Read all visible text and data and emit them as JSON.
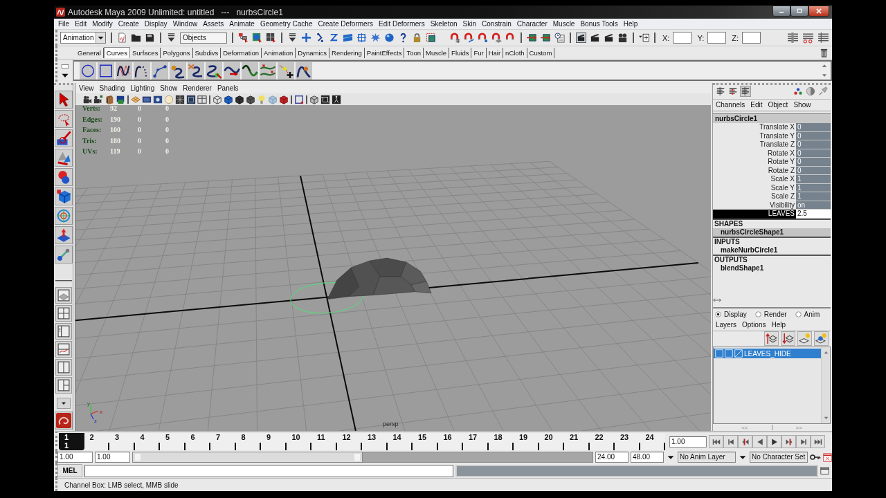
{
  "window": {
    "title": "Autodesk Maya 2009 Unlimited: untitled   ---   nurbsCircle1"
  },
  "menu_bar": [
    "File",
    "Edit",
    "Modify",
    "Create",
    "Display",
    "Window",
    "Assets",
    "Animate",
    "Geometry Cache",
    "Create Deformers",
    "Edit Deformers",
    "Skeleton",
    "Skin",
    "Constrain",
    "Character",
    "Muscle",
    "Bonus Tools",
    "Help"
  ],
  "status_line": {
    "menu_set": "Animation",
    "selection_mode": "Objects",
    "coordinates": [
      "X:",
      "Y:",
      "Z:"
    ]
  },
  "shelf": {
    "tabs": [
      {
        "label": "General",
        "selected": false
      },
      {
        "label": "Curves",
        "selected": true
      },
      {
        "label": "Surfaces",
        "selected": false
      },
      {
        "label": "Polygons",
        "selected": false
      },
      {
        "label": "Subdivs",
        "selected": false
      },
      {
        "label": "Deformation",
        "selected": false
      },
      {
        "label": "Animation",
        "selected": false
      },
      {
        "label": "Dynamics",
        "selected": false
      },
      {
        "label": "Rendering",
        "selected": false
      },
      {
        "label": "PaintEffects",
        "selected": false
      },
      {
        "label": "Toon",
        "selected": false
      },
      {
        "label": "Muscle",
        "selected": false
      },
      {
        "label": "Fluids",
        "selected": false
      },
      {
        "label": "Fur",
        "selected": false
      },
      {
        "label": "Hair",
        "selected": false
      },
      {
        "label": "nCloth",
        "selected": false
      },
      {
        "label": "Custom",
        "selected": false
      }
    ]
  },
  "viewport": {
    "menu": [
      "View",
      "Shading",
      "Lighting",
      "Show",
      "Renderer",
      "Panels"
    ],
    "hud": [
      {
        "label": "Verts:",
        "values": [
          "92",
          "0",
          "0"
        ]
      },
      {
        "label": "Edges:",
        "values": [
          "190",
          "0",
          "0"
        ]
      },
      {
        "label": "Faces:",
        "values": [
          "100",
          "0",
          "0"
        ]
      },
      {
        "label": "Tris:",
        "values": [
          "180",
          "0",
          "0"
        ]
      },
      {
        "label": "UVs:",
        "values": [
          "119",
          "0",
          "0"
        ]
      }
    ],
    "camera": "persp",
    "axis_labels": [
      "y",
      "x",
      "z"
    ]
  },
  "channel_box": {
    "menu": [
      "Channels",
      "Edit",
      "Object",
      "Show"
    ],
    "node": "nurbsCircle1",
    "channels": [
      {
        "name": "Translate X",
        "value": "0",
        "selected": false
      },
      {
        "name": "Translate Y",
        "value": "0",
        "selected": false
      },
      {
        "name": "Translate Z",
        "value": "0",
        "selected": false
      },
      {
        "name": "Rotate X",
        "value": "0",
        "selected": false
      },
      {
        "name": "Rotate Y",
        "value": "0",
        "selected": false
      },
      {
        "name": "Rotate Z",
        "value": "0",
        "selected": false
      },
      {
        "name": "Scale X",
        "value": "1",
        "selected": false
      },
      {
        "name": "Scale Y",
        "value": "1",
        "selected": false
      },
      {
        "name": "Scale Z",
        "value": "1",
        "selected": false
      },
      {
        "name": "Visibility",
        "value": "on",
        "selected": false
      },
      {
        "name": "LEAVES",
        "value": "2.5",
        "selected": true
      }
    ],
    "sections": [
      {
        "heading": "SHAPES",
        "nodes": [
          {
            "name": "nurbsCircleShape1",
            "selected": true
          }
        ]
      },
      {
        "heading": "INPUTS",
        "nodes": [
          {
            "name": "makeNurbCircle1",
            "selected": false
          }
        ]
      },
      {
        "heading": "OUTPUTS",
        "nodes": [
          {
            "name": "blendShape1",
            "selected": false
          }
        ]
      }
    ]
  },
  "layer_editor": {
    "modes": [
      {
        "label": "Display",
        "selected": true
      },
      {
        "label": "Render",
        "selected": false
      },
      {
        "label": "Anim",
        "selected": false
      }
    ],
    "menu": [
      "Layers",
      "Options",
      "Help"
    ],
    "layers": [
      {
        "name": "LEAVES_HIDE",
        "selected": true,
        "visible": false
      }
    ],
    "pager": [
      "<<",
      ">>"
    ]
  },
  "timeline": {
    "frames": [
      {
        "label": "1",
        "selected": true
      },
      {
        "label": "2",
        "selected": false
      },
      {
        "label": "3",
        "selected": false
      },
      {
        "label": "4",
        "selected": false
      },
      {
        "label": "5",
        "selected": false
      },
      {
        "label": "6",
        "selected": false
      },
      {
        "label": "7",
        "selected": false
      },
      {
        "label": "8",
        "selected": false
      },
      {
        "label": "9",
        "selected": false
      },
      {
        "label": "10",
        "selected": false
      },
      {
        "label": "11",
        "selected": false
      },
      {
        "label": "12",
        "selected": false
      },
      {
        "label": "13",
        "selected": false
      },
      {
        "label": "14",
        "selected": false
      },
      {
        "label": "15",
        "selected": false
      },
      {
        "label": "16",
        "selected": false
      },
      {
        "label": "17",
        "selected": false
      },
      {
        "label": "18",
        "selected": false
      },
      {
        "label": "19",
        "selected": false
      },
      {
        "label": "20",
        "selected": false
      },
      {
        "label": "21",
        "selected": false
      },
      {
        "label": "22",
        "selected": false
      },
      {
        "label": "23",
        "selected": false
      },
      {
        "label": "24",
        "selected": false
      }
    ],
    "current_frame": "1",
    "current_time": "1.00"
  },
  "range_slider": {
    "start_time": "1.00",
    "playback_start": "1.00",
    "level": 0.5,
    "playback_end": "24.00",
    "end_time": "48.00",
    "anim_layer": "No Anim Layer",
    "character_set": "No Character Set"
  },
  "command_line": {
    "language": "MEL"
  },
  "help_line": "Channel Box: LMB select, MMB slide"
}
